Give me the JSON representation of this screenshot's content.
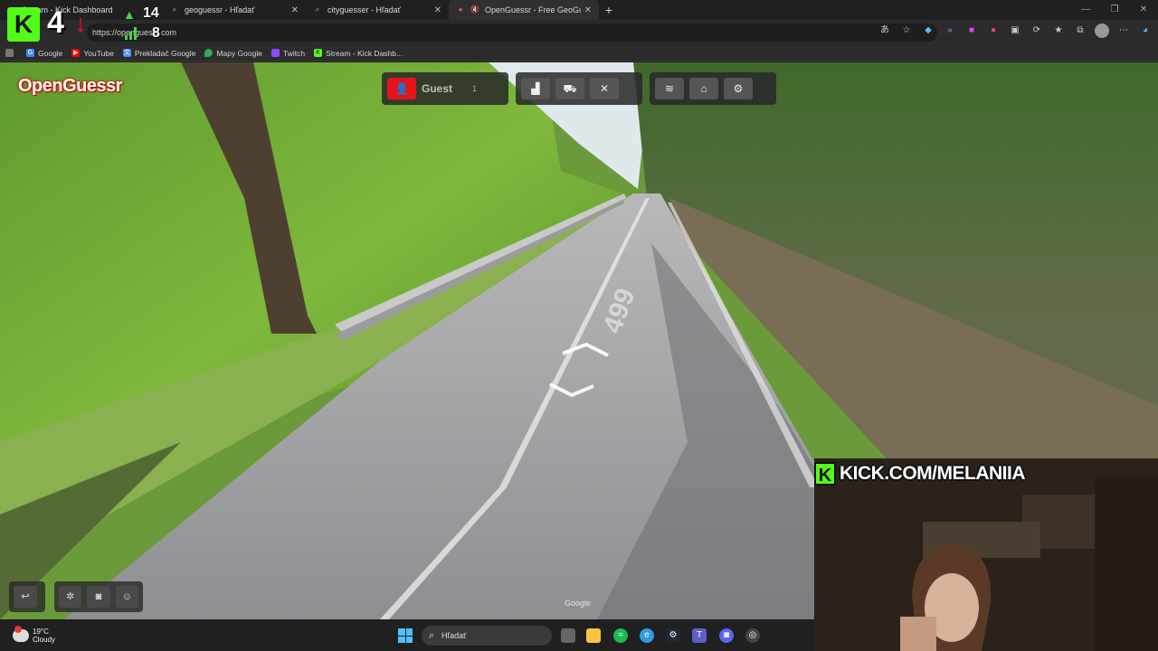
{
  "browser": {
    "tabs": [
      {
        "title": "Stream - Kick Dashboard",
        "favicon": "kick-icon",
        "active": false
      },
      {
        "title": "geoguessr - Hľadať",
        "favicon": "search-icon",
        "active": false
      },
      {
        "title": "cityguesser - Hľadať",
        "favicon": "search-icon",
        "active": false
      },
      {
        "title": "OpenGuessr - Free GeoGuessr",
        "favicon": "opera-icon",
        "active": true
      }
    ],
    "new_tab": "+",
    "url": "https://openguessr.com",
    "bookmarks": [
      {
        "label": "Google",
        "icon": "google-icon",
        "color": "#4285f4"
      },
      {
        "label": "YouTube",
        "icon": "youtube-icon",
        "color": "#ff0000"
      },
      {
        "label": "Prekladač Google",
        "icon": "translate-icon",
        "color": "#4a8af4"
      },
      {
        "label": "Mapy Google",
        "icon": "maps-icon",
        "color": "#34a853"
      },
      {
        "label": "Twitch",
        "icon": "twitch-icon",
        "color": "#9146ff"
      },
      {
        "label": "Stream - Kick Dashb...",
        "icon": "kick-icon",
        "color": "#53fc18"
      }
    ]
  },
  "game": {
    "logo": "OpenGuessr",
    "player_name": "Guest",
    "player_count": "1",
    "road_number": "499",
    "watermark": "Google"
  },
  "stream_overlay": {
    "kick_letter": "K",
    "follower_delta": "4",
    "viewers": "14",
    "secondary_count": "8",
    "channel_url": "KICK.COM/MELANIIA",
    "brand_color": "#53fc18"
  },
  "taskbar": {
    "temperature": "19°C",
    "condition": "Cloudy",
    "search_placeholder": "Hľadať"
  }
}
